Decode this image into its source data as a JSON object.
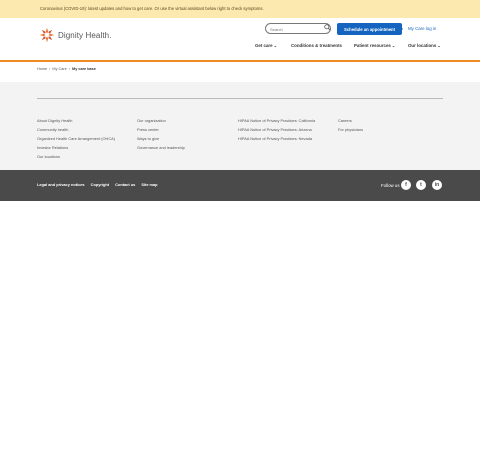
{
  "alert": {
    "text": "Coronavirus (COVID-19): latest updates and how to get care. Or use the virtual assistant below right to check symptoms."
  },
  "header": {
    "logo_text": "Dignity Health.",
    "search_placeholder": "Search",
    "schedule_label": "Schedule an appointment",
    "login_label": "My Care log in",
    "nav": [
      {
        "label": "Get care"
      },
      {
        "label": "Conditions & treatments"
      },
      {
        "label": "Patient resources"
      },
      {
        "label": "Our locations"
      }
    ],
    "accent_color": "#f08a24",
    "button_color": "#1565c0"
  },
  "breadcrumb": {
    "items": [
      "Home",
      "My Care",
      "My care base"
    ]
  },
  "footer": {
    "columns": [
      [
        "About Dignity Health",
        "Community health",
        "Organized Health Care Arrangement (OHCA)",
        "Investor Relations",
        "Our locations"
      ],
      [
        "Our organization",
        "Press center",
        "Ways to give",
        "Governance and leadership"
      ],
      [
        "HIPAA Notice of Privacy Practices: California",
        "HIPAA Notice of Privacy Practices: Arizona",
        "HIPAA Notice of Privacy Practices: Nevada"
      ],
      [
        "Careers",
        "For physicians"
      ]
    ],
    "legal_links": [
      "Legal and privacy notices",
      "Copyright",
      "Contact us",
      "Site map"
    ],
    "follow_label": "Follow us",
    "social": [
      {
        "icon": "facebook-icon",
        "glyph": "f"
      },
      {
        "icon": "twitter-icon",
        "glyph": "t"
      },
      {
        "icon": "linkedin-icon",
        "glyph": "in"
      }
    ]
  }
}
